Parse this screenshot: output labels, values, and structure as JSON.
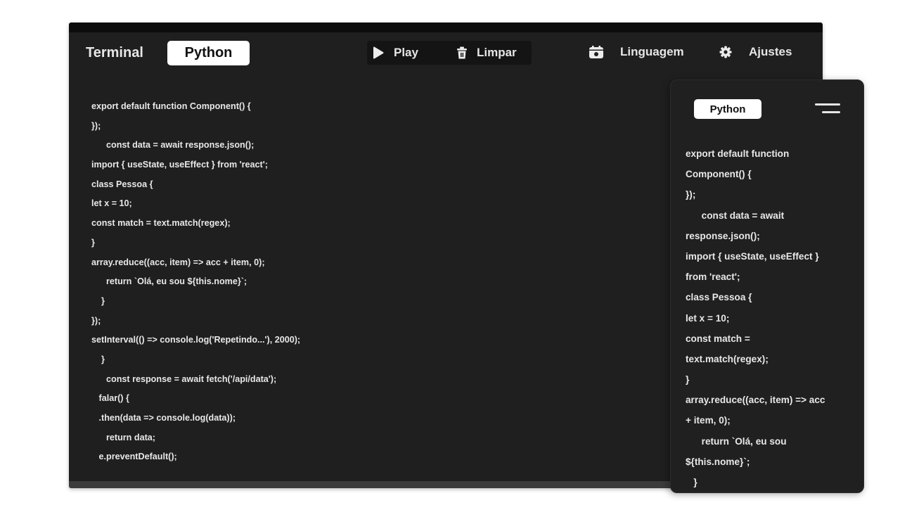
{
  "header": {
    "terminal_tab": "Terminal",
    "python_tab": "Python",
    "play_label": "Play",
    "clear_label": "Limpar",
    "language_label": "Linguagem",
    "settings_label": "Ajustes"
  },
  "icons": {
    "play": "play-icon",
    "clear": "trash-icon",
    "language": "language-icon",
    "settings": "gear-icon",
    "menu": "hamburger-menu-icon"
  },
  "colors": {
    "background": "#1f1f1f",
    "text": "#e8e8e8",
    "pill": "#ffffff"
  },
  "code": [
    "export default function Component() {",
    "});",
    "      const data = await response.json();",
    "import { useState, useEffect } from 'react';",
    "class Pessoa {",
    "let x = 10;",
    "const match = text.match(regex);",
    "}",
    "array.reduce((acc, item) => acc + item, 0);",
    "      return `Olá, eu sou ${this.nome}`;",
    "    }",
    "});",
    "setInterval(() => console.log('Repetindo...'), 2000);",
    "    }",
    "      const response = await fetch('/api/data');",
    "   falar() {",
    "   .then(data => console.log(data));",
    "      return data;",
    "   e.preventDefault();"
  ],
  "mobile": {
    "tab_label": "Python",
    "code": [
      "export default function",
      "Component() {",
      "});",
      "      const data = await",
      "response.json();",
      "import { useState, useEffect }",
      "from 'react';",
      "class Pessoa {",
      "let x = 10;",
      "const match =",
      "text.match(regex);",
      "}",
      "array.reduce((acc, item) => acc",
      "+ item, 0);",
      "      return `Olá, eu sou",
      "${this.nome}`;",
      "   }"
    ]
  }
}
